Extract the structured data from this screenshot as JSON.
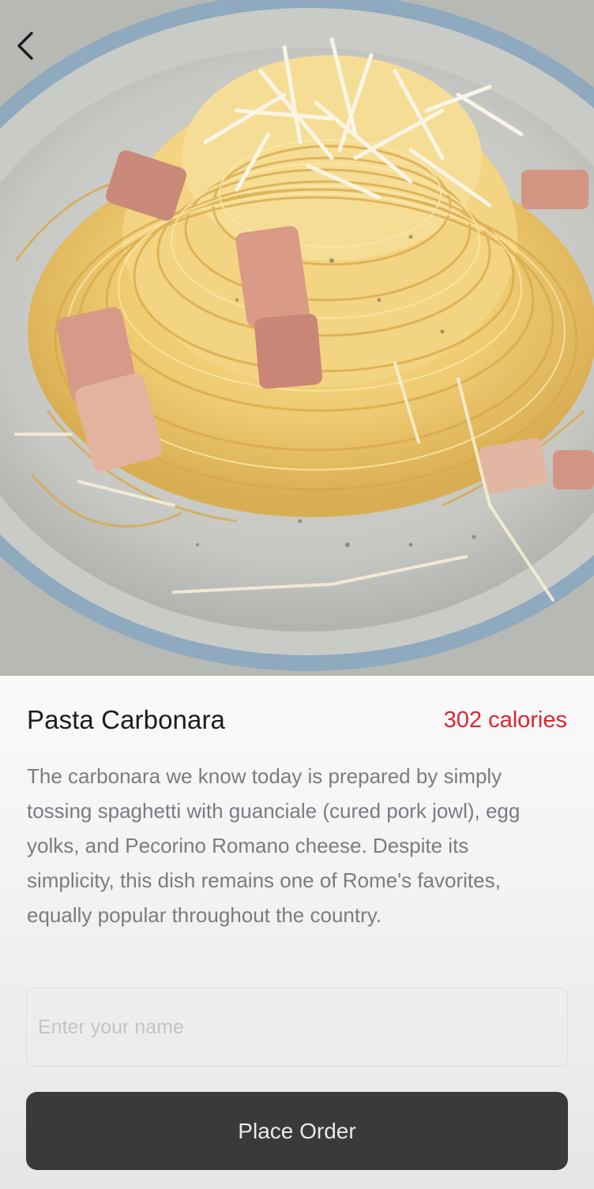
{
  "navigation": {
    "back_icon": "chevron-left-icon"
  },
  "dish": {
    "title": "Pasta Carbonara",
    "calories": "302 calories",
    "description": "The carbonara we know today is prepared by simply tossing spaghetti with guanciale (cured pork jowl), egg yolks, and Pecorino Romano cheese. Despite its simplicity, this dish remains one of Rome's favorites, equally popular throughout the country."
  },
  "order_form": {
    "name_placeholder": "Enter your name",
    "name_value": "",
    "submit_label": "Place Order"
  },
  "colors": {
    "calories_accent": "#e0242c",
    "button_background": "#3a3a3c",
    "button_text": "#e9e9ec"
  }
}
